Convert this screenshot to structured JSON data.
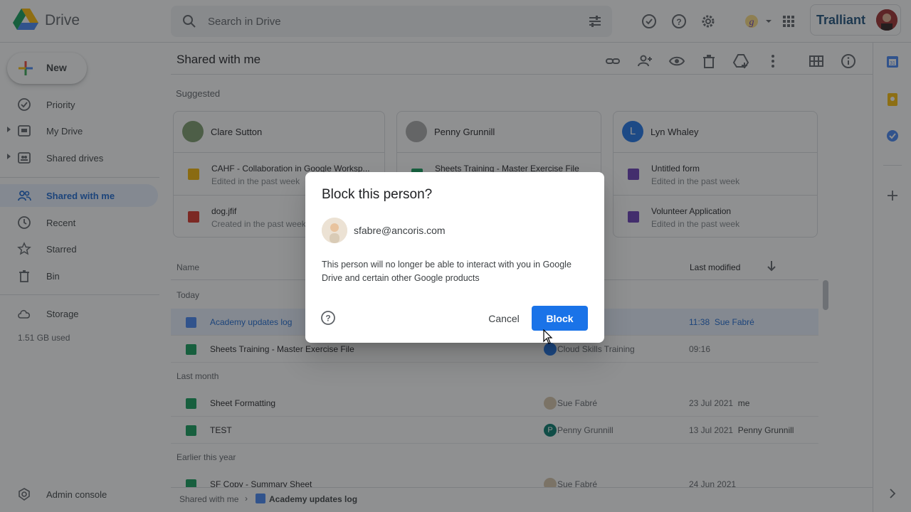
{
  "topbar": {
    "app_name": "Drive",
    "search_placeholder": "Search in Drive",
    "org_name": "Tralliant"
  },
  "sidebar": {
    "new_label": "New",
    "items": [
      {
        "label": "Priority",
        "icon": "priority-icon"
      },
      {
        "label": "My Drive",
        "icon": "my-drive-icon"
      },
      {
        "label": "Shared drives",
        "icon": "shared-drives-icon"
      },
      {
        "label": "Shared with me",
        "icon": "shared-with-me-icon",
        "active": true
      },
      {
        "label": "Recent",
        "icon": "clock-icon"
      },
      {
        "label": "Starred",
        "icon": "star-icon"
      },
      {
        "label": "Bin",
        "icon": "trash-icon"
      },
      {
        "label": "Storage",
        "icon": "cloud-icon"
      }
    ],
    "storage_used": "1.51 GB used",
    "admin_label": "Admin console"
  },
  "main": {
    "title": "Shared with me",
    "suggested_label": "Suggested",
    "cards": [
      {
        "owner": "Clare Sutton",
        "files": [
          {
            "name": "CAHF - Collaboration in Google Worksp...",
            "sub": "Edited in the past week",
            "type": "slides"
          },
          {
            "name": "dog.jfif",
            "sub": "Created in the past week",
            "type": "image"
          }
        ]
      },
      {
        "owner": "Penny Grunnill",
        "files": [
          {
            "name": "Sheets Training - Master Exercise File",
            "sub": "",
            "type": "sheets"
          }
        ]
      },
      {
        "owner": "Lyn Whaley",
        "owner_initial": "L",
        "files": [
          {
            "name": "Untitled form",
            "sub": "Edited in the past week",
            "type": "forms"
          },
          {
            "name": "Volunteer Application",
            "sub": "Edited in the past week",
            "type": "forms"
          }
        ]
      }
    ],
    "list_header": {
      "name": "Name",
      "modified": "Last modified"
    },
    "groups": {
      "today": "Today",
      "last_month": "Last month",
      "earlier": "Earlier this year"
    },
    "rows": [
      {
        "name": "Academy updates log",
        "owner": "",
        "modified": "11:38",
        "modified_by": "Sue Fabré",
        "type": "docs"
      },
      {
        "name": "Sheets Training - Master Exercise File",
        "owner": "Cloud Skills Training",
        "modified": "09:16",
        "modified_by": "",
        "type": "sheets"
      },
      {
        "name": "Sheet Formatting",
        "owner": "Sue Fabré",
        "modified": "23 Jul 2021",
        "modified_by": "me",
        "type": "sheets"
      },
      {
        "name": "TEST",
        "owner": "Penny Grunnill",
        "owner_initial": "P",
        "modified": "13 Jul 2021",
        "modified_by": "Penny Grunnill",
        "type": "sheets"
      },
      {
        "name": "SF Copy - Summary Sheet",
        "owner": "Sue Fabré",
        "modified": "24 Jun 2021",
        "modified_by": "",
        "type": "sheets"
      }
    ],
    "breadcrumb": {
      "root": "Shared with me",
      "current": "Academy updates log"
    }
  },
  "dialog": {
    "title": "Block this person?",
    "email": "sfabre@ancoris.com",
    "body": "This person will no longer be able to interact with you in Google Drive and certain other Google products",
    "cancel_label": "Cancel",
    "block_label": "Block"
  },
  "colors": {
    "accent": "#1a73e8",
    "sheets": "#0f9d58",
    "docs": "#4285f4",
    "forms": "#673ab7",
    "slides": "#f4b400",
    "image": "#d93025"
  }
}
